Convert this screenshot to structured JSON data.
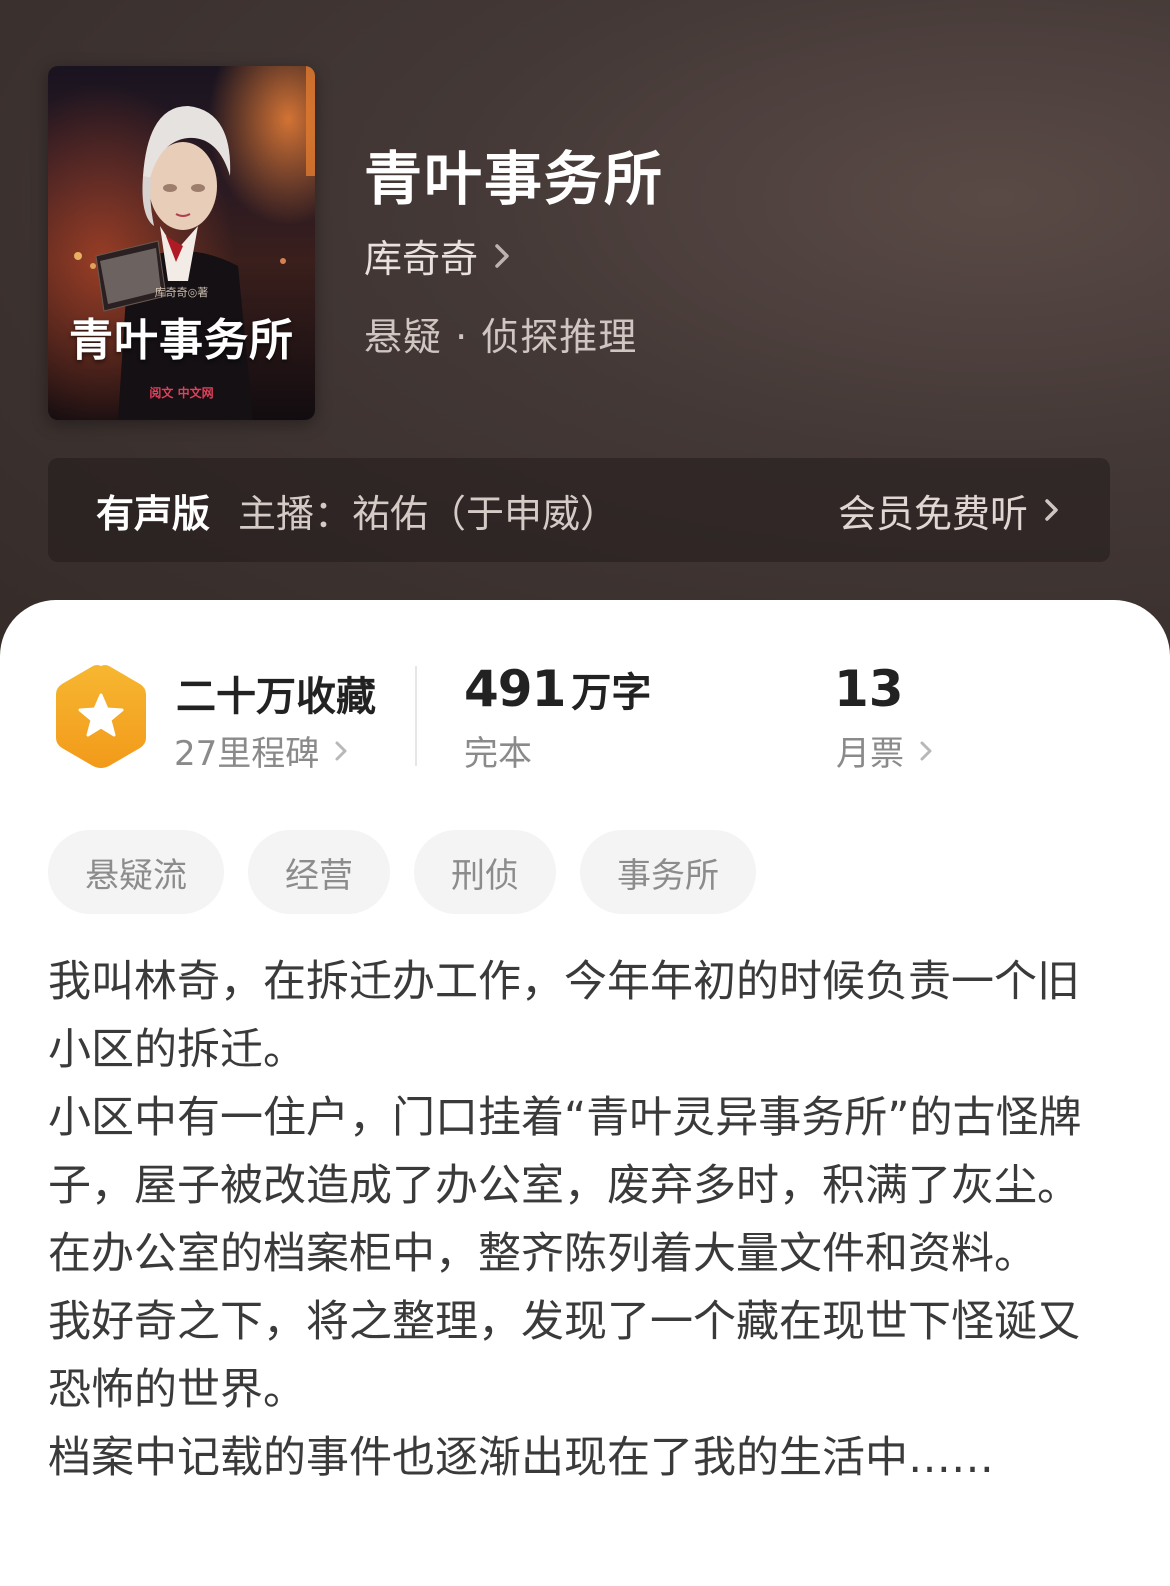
{
  "book": {
    "title": "青叶事务所",
    "author": "库奇奇",
    "genre": "悬疑 · 侦探推理",
    "cover": {
      "title": "青叶事务所",
      "author_line": "库奇奇◎著",
      "publisher": "阅文 中文网"
    }
  },
  "audio": {
    "label": "有声版",
    "host": "主播：祐佑（于申威）",
    "cta": "会员免费听"
  },
  "stats": {
    "collections": {
      "main": "二十万收藏",
      "sub": "27里程碑"
    },
    "words": {
      "number": "491",
      "unit": "万字",
      "sub": "完本"
    },
    "tickets": {
      "number": "13",
      "sub": "月票"
    }
  },
  "tags": [
    "悬疑流",
    "经营",
    "刑侦",
    "事务所"
  ],
  "synopsis": [
    "我叫林奇，在拆迁办工作，今年年初的时候负责一个旧小区的拆迁。",
    "小区中有一住户，门口挂着“青叶灵异事务所”的古怪牌子，屋子被改造成了办公室，废弃多时，积满了灰尘。在办公室的档案柜中，整齐陈列着大量文件和资料。",
    "我好奇之下，将之整理，发现了一个藏在现世下怪诞又恐怖的世界。",
    "档案中记载的事件也逐渐出现在了我的生活中……"
  ],
  "colors": {
    "hero_bg": "#3d3230",
    "badge_orange": "#f5a623",
    "tag_bg": "#f4f4f4"
  }
}
